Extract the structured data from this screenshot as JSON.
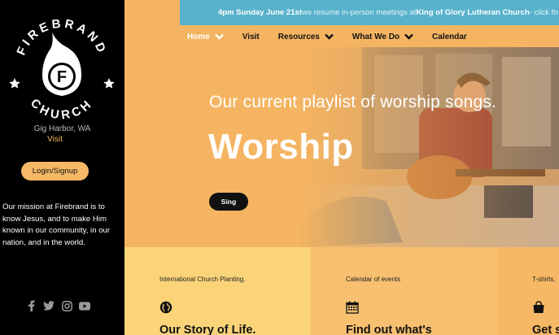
{
  "colors": {
    "sidebar_bg": "#000000",
    "accent_orange": "#f5b461",
    "announce_blue": "#58b2cc"
  },
  "sidebar": {
    "logo_text_top": "FIREBRAND",
    "logo_text_bottom": "CHURCH",
    "logo_letter": "F",
    "location": "Gig Harbor, WA",
    "visit_label": "Visit",
    "login_label": "Login/Signup",
    "mission": "Our mission at Firebrand is to know Jesus, and to make Him known in our community, in our nation, and in the world.",
    "social_icons": [
      "facebook-icon",
      "twitter-icon",
      "instagram-icon",
      "youtube-icon"
    ]
  },
  "announcement": {
    "date": "4pm Sunday June 21st",
    "text": " we resume in-person meetings at ",
    "place": "King of Glory Lutheran Church",
    "trail": " - click fo"
  },
  "nav": {
    "items": [
      {
        "label": "Home",
        "has_dropdown": true
      },
      {
        "label": "Visit",
        "has_dropdown": false
      },
      {
        "label": "Resources",
        "has_dropdown": true
      },
      {
        "label": "What We Do",
        "has_dropdown": true
      },
      {
        "label": "Calendar",
        "has_dropdown": false
      }
    ]
  },
  "hero": {
    "subtitle": "Our current playlist of worship songs.",
    "title": "Worship",
    "button_label": "Sing"
  },
  "cards": [
    {
      "kicker": "International Church Planting.",
      "icon": "globe-icon",
      "heading": "Our Story of Life."
    },
    {
      "kicker": "Calendar of events",
      "icon": "calendar-icon",
      "heading": "Find out what's"
    },
    {
      "kicker": "T-shirts,",
      "icon": "shopping-bag-icon",
      "heading": "Get s"
    }
  ]
}
